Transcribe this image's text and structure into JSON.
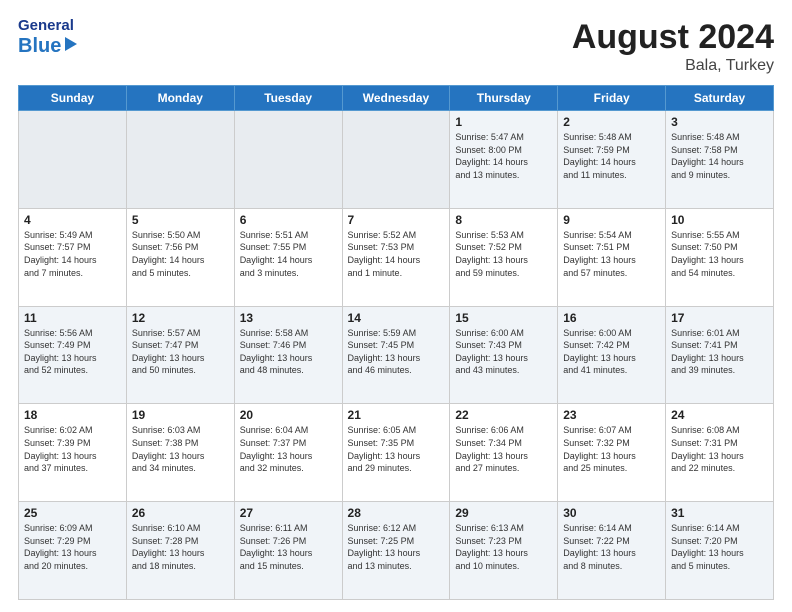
{
  "header": {
    "logo_general": "General",
    "logo_blue": "Blue",
    "month_title": "August 2024",
    "location": "Bala, Turkey"
  },
  "days_of_week": [
    "Sunday",
    "Monday",
    "Tuesday",
    "Wednesday",
    "Thursday",
    "Friday",
    "Saturday"
  ],
  "weeks": [
    [
      {
        "day": "",
        "info": ""
      },
      {
        "day": "",
        "info": ""
      },
      {
        "day": "",
        "info": ""
      },
      {
        "day": "",
        "info": ""
      },
      {
        "day": "1",
        "info": "Sunrise: 5:47 AM\nSunset: 8:00 PM\nDaylight: 14 hours\nand 13 minutes."
      },
      {
        "day": "2",
        "info": "Sunrise: 5:48 AM\nSunset: 7:59 PM\nDaylight: 14 hours\nand 11 minutes."
      },
      {
        "day": "3",
        "info": "Sunrise: 5:48 AM\nSunset: 7:58 PM\nDaylight: 14 hours\nand 9 minutes."
      }
    ],
    [
      {
        "day": "4",
        "info": "Sunrise: 5:49 AM\nSunset: 7:57 PM\nDaylight: 14 hours\nand 7 minutes."
      },
      {
        "day": "5",
        "info": "Sunrise: 5:50 AM\nSunset: 7:56 PM\nDaylight: 14 hours\nand 5 minutes."
      },
      {
        "day": "6",
        "info": "Sunrise: 5:51 AM\nSunset: 7:55 PM\nDaylight: 14 hours\nand 3 minutes."
      },
      {
        "day": "7",
        "info": "Sunrise: 5:52 AM\nSunset: 7:53 PM\nDaylight: 14 hours\nand 1 minute."
      },
      {
        "day": "8",
        "info": "Sunrise: 5:53 AM\nSunset: 7:52 PM\nDaylight: 13 hours\nand 59 minutes."
      },
      {
        "day": "9",
        "info": "Sunrise: 5:54 AM\nSunset: 7:51 PM\nDaylight: 13 hours\nand 57 minutes."
      },
      {
        "day": "10",
        "info": "Sunrise: 5:55 AM\nSunset: 7:50 PM\nDaylight: 13 hours\nand 54 minutes."
      }
    ],
    [
      {
        "day": "11",
        "info": "Sunrise: 5:56 AM\nSunset: 7:49 PM\nDaylight: 13 hours\nand 52 minutes."
      },
      {
        "day": "12",
        "info": "Sunrise: 5:57 AM\nSunset: 7:47 PM\nDaylight: 13 hours\nand 50 minutes."
      },
      {
        "day": "13",
        "info": "Sunrise: 5:58 AM\nSunset: 7:46 PM\nDaylight: 13 hours\nand 48 minutes."
      },
      {
        "day": "14",
        "info": "Sunrise: 5:59 AM\nSunset: 7:45 PM\nDaylight: 13 hours\nand 46 minutes."
      },
      {
        "day": "15",
        "info": "Sunrise: 6:00 AM\nSunset: 7:43 PM\nDaylight: 13 hours\nand 43 minutes."
      },
      {
        "day": "16",
        "info": "Sunrise: 6:00 AM\nSunset: 7:42 PM\nDaylight: 13 hours\nand 41 minutes."
      },
      {
        "day": "17",
        "info": "Sunrise: 6:01 AM\nSunset: 7:41 PM\nDaylight: 13 hours\nand 39 minutes."
      }
    ],
    [
      {
        "day": "18",
        "info": "Sunrise: 6:02 AM\nSunset: 7:39 PM\nDaylight: 13 hours\nand 37 minutes."
      },
      {
        "day": "19",
        "info": "Sunrise: 6:03 AM\nSunset: 7:38 PM\nDaylight: 13 hours\nand 34 minutes."
      },
      {
        "day": "20",
        "info": "Sunrise: 6:04 AM\nSunset: 7:37 PM\nDaylight: 13 hours\nand 32 minutes."
      },
      {
        "day": "21",
        "info": "Sunrise: 6:05 AM\nSunset: 7:35 PM\nDaylight: 13 hours\nand 29 minutes."
      },
      {
        "day": "22",
        "info": "Sunrise: 6:06 AM\nSunset: 7:34 PM\nDaylight: 13 hours\nand 27 minutes."
      },
      {
        "day": "23",
        "info": "Sunrise: 6:07 AM\nSunset: 7:32 PM\nDaylight: 13 hours\nand 25 minutes."
      },
      {
        "day": "24",
        "info": "Sunrise: 6:08 AM\nSunset: 7:31 PM\nDaylight: 13 hours\nand 22 minutes."
      }
    ],
    [
      {
        "day": "25",
        "info": "Sunrise: 6:09 AM\nSunset: 7:29 PM\nDaylight: 13 hours\nand 20 minutes."
      },
      {
        "day": "26",
        "info": "Sunrise: 6:10 AM\nSunset: 7:28 PM\nDaylight: 13 hours\nand 18 minutes."
      },
      {
        "day": "27",
        "info": "Sunrise: 6:11 AM\nSunset: 7:26 PM\nDaylight: 13 hours\nand 15 minutes."
      },
      {
        "day": "28",
        "info": "Sunrise: 6:12 AM\nSunset: 7:25 PM\nDaylight: 13 hours\nand 13 minutes."
      },
      {
        "day": "29",
        "info": "Sunrise: 6:13 AM\nSunset: 7:23 PM\nDaylight: 13 hours\nand 10 minutes."
      },
      {
        "day": "30",
        "info": "Sunrise: 6:14 AM\nSunset: 7:22 PM\nDaylight: 13 hours\nand 8 minutes."
      },
      {
        "day": "31",
        "info": "Sunrise: 6:14 AM\nSunset: 7:20 PM\nDaylight: 13 hours\nand 5 minutes."
      }
    ]
  ]
}
